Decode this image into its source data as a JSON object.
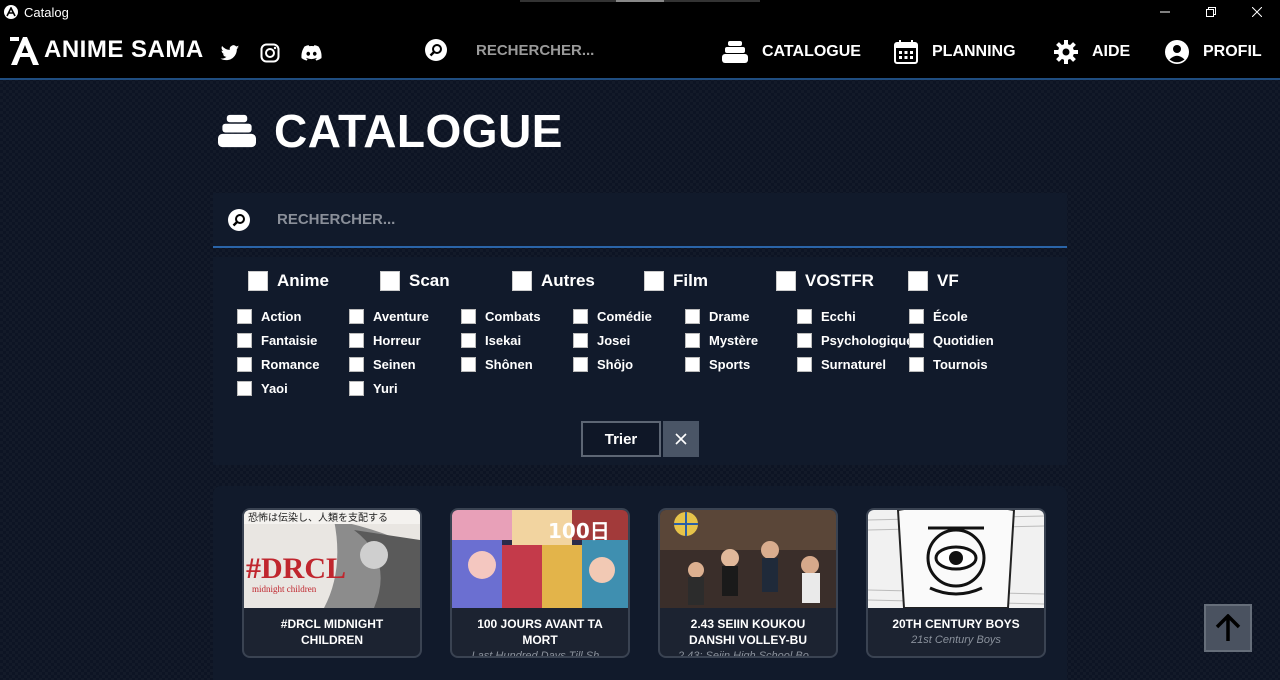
{
  "window": {
    "title": "Catalog"
  },
  "header": {
    "logo_text": "ANIME SAMA",
    "social": [
      "twitter-icon",
      "instagram-icon",
      "discord-icon"
    ],
    "search_placeholder": "RECHERCHER...",
    "nav": [
      {
        "label": "CATALOGUE",
        "icon": "catalogue-icon"
      },
      {
        "label": "PLANNING",
        "icon": "calendar-icon"
      },
      {
        "label": "AIDE",
        "icon": "gear-icon"
      },
      {
        "label": "PROFIL",
        "icon": "user-icon"
      }
    ]
  },
  "page": {
    "title": "CATALOGUE"
  },
  "search": {
    "placeholder": "RECHERCHER..."
  },
  "filters": {
    "types": [
      "Anime",
      "Scan",
      "Autres",
      "Film",
      "VOSTFR",
      "VF"
    ],
    "genres": [
      [
        "Action",
        "Aventure",
        "Combats",
        "Comédie",
        "Drame",
        "Ecchi",
        "École"
      ],
      [
        "Fantaisie",
        "Horreur",
        "Isekai",
        "Josei",
        "Mystère",
        "Psychologique",
        "Quotidien"
      ],
      [
        "Romance",
        "Seinen",
        "Shônen",
        "Shôjo",
        "Sports",
        "Surnaturel",
        "Tournois"
      ],
      [
        "Yaoi",
        "Yuri"
      ]
    ],
    "sort_label": "Trier",
    "clear_icon": "close-icon"
  },
  "cards": [
    {
      "title": "#DRCL MIDNIGHT CHILDREN",
      "alt": "",
      "cover_text": "#DRCL",
      "cover_sub": "midnight children",
      "cover_banner": "恐怖は伝染し、人類を支配する"
    },
    {
      "title": "100 JOURS AVANT TA MORT",
      "alt": "Last Hundred Days Till Sh...",
      "cover_text": "100日"
    },
    {
      "title": "2.43 SEIIN KOUKOU DANSHI VOLLEY-BU",
      "alt": "2.43: Seiin High School Bo...",
      "cover_text": ""
    },
    {
      "title": "20TH CENTURY BOYS",
      "alt": "21st Century Boys",
      "cover_text": ""
    }
  ],
  "colors": {
    "accent": "#2a64a8",
    "panel": "#111a2b",
    "background": "#0d1424"
  }
}
